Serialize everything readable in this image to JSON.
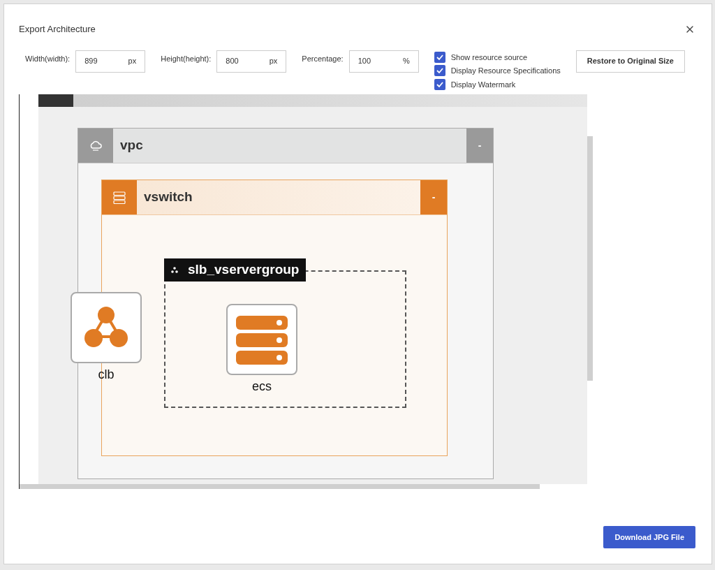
{
  "dialog": {
    "title": "Export Architecture"
  },
  "fields": [
    {
      "label": "Width(width):",
      "value": "899",
      "unit": "px"
    },
    {
      "label": "Height(height):",
      "value": "800",
      "unit": "px"
    },
    {
      "label": "Percentage:",
      "value": "100",
      "unit": "%"
    }
  ],
  "checkboxes": [
    {
      "label": "Show resource source",
      "checked": true
    },
    {
      "label": "Display Resource Specifications",
      "checked": true
    },
    {
      "label": "Display Watermark",
      "checked": true
    }
  ],
  "restore_button": "Restore to Original Size",
  "diagram": {
    "vpc": {
      "title": "vpc",
      "toggle": "-"
    },
    "vswitch": {
      "title": "vswitch",
      "toggle": "-"
    },
    "server_group": {
      "title": "slb_vservergroup"
    },
    "nodes": [
      {
        "kind": "loadbalancer",
        "label": "clb"
      },
      {
        "kind": "server",
        "label": "ecs"
      }
    ]
  },
  "download_button": "Download JPG File"
}
